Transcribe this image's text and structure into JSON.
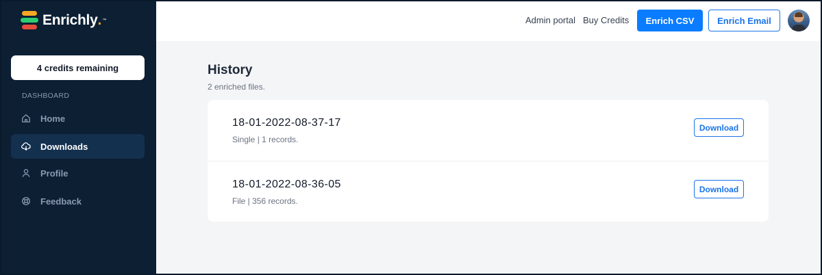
{
  "brand": {
    "name": "Enrichly",
    "dot": ".",
    "tm": "™",
    "colors": {
      "accent1": "#f5a623",
      "accent2": "#2ecc71",
      "accent3": "#e74c3c",
      "primary": "#0a7cff",
      "sidebar_bg": "#0c1f33"
    }
  },
  "sidebar": {
    "credits_label": "4 credits remaining",
    "section_label": "DASHBOARD",
    "items": [
      {
        "label": "Home",
        "icon": "home-icon",
        "active": false
      },
      {
        "label": "Downloads",
        "icon": "cloud-download-icon",
        "active": true
      },
      {
        "label": "Profile",
        "icon": "user-icon",
        "active": false
      },
      {
        "label": "Feedback",
        "icon": "lifebuoy-icon",
        "active": false
      }
    ]
  },
  "header": {
    "admin_portal": "Admin portal",
    "buy_credits": "Buy Credits",
    "enrich_csv": "Enrich CSV",
    "enrich_email": "Enrich Email",
    "avatar_icon": "user-avatar"
  },
  "main": {
    "title": "History",
    "subtitle": "2 enriched files.",
    "rows": [
      {
        "name": "18-01-2022-08-37-17",
        "meta": "Single | 1 records.",
        "action": "Download"
      },
      {
        "name": "18-01-2022-08-36-05",
        "meta": "File | 356 records.",
        "action": "Download"
      }
    ]
  }
}
